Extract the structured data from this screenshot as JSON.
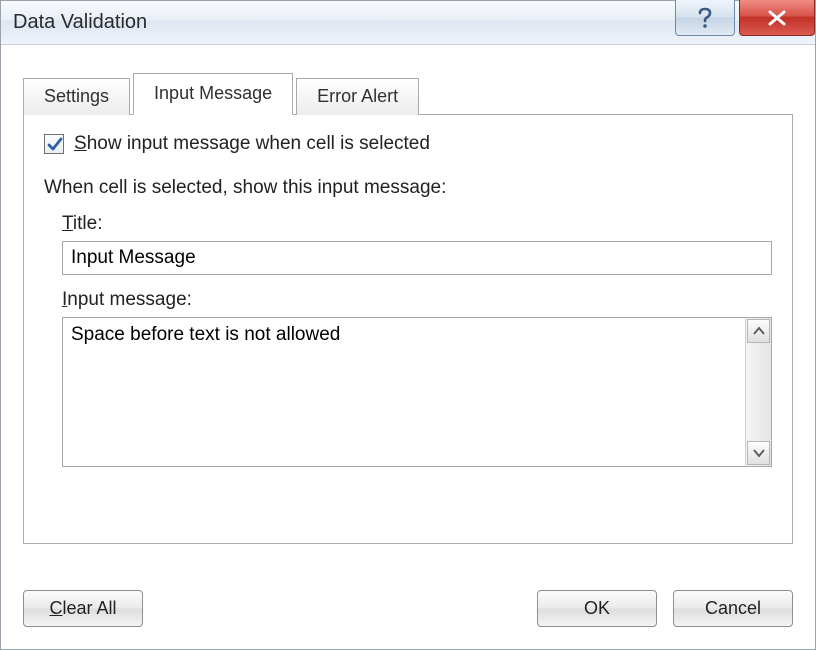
{
  "window": {
    "title": "Data Validation"
  },
  "tabs": {
    "settings": "Settings",
    "input_message": "Input Message",
    "error_alert": "Error Alert",
    "active": "input_message"
  },
  "panel": {
    "checkbox_label_pre": "S",
    "checkbox_label_rest": "how input message when cell is selected",
    "checkbox_checked": true,
    "section_heading": "When cell is selected, show this input message:",
    "title_label_pre": "T",
    "title_label_rest": "itle:",
    "title_value": "Input Message",
    "message_label_pre": "I",
    "message_label_rest": "nput message:",
    "message_value": "Space before text is not allowed"
  },
  "buttons": {
    "clear_all_pre": "C",
    "clear_all_rest": "lear All",
    "ok": "OK",
    "cancel": "Cancel"
  }
}
